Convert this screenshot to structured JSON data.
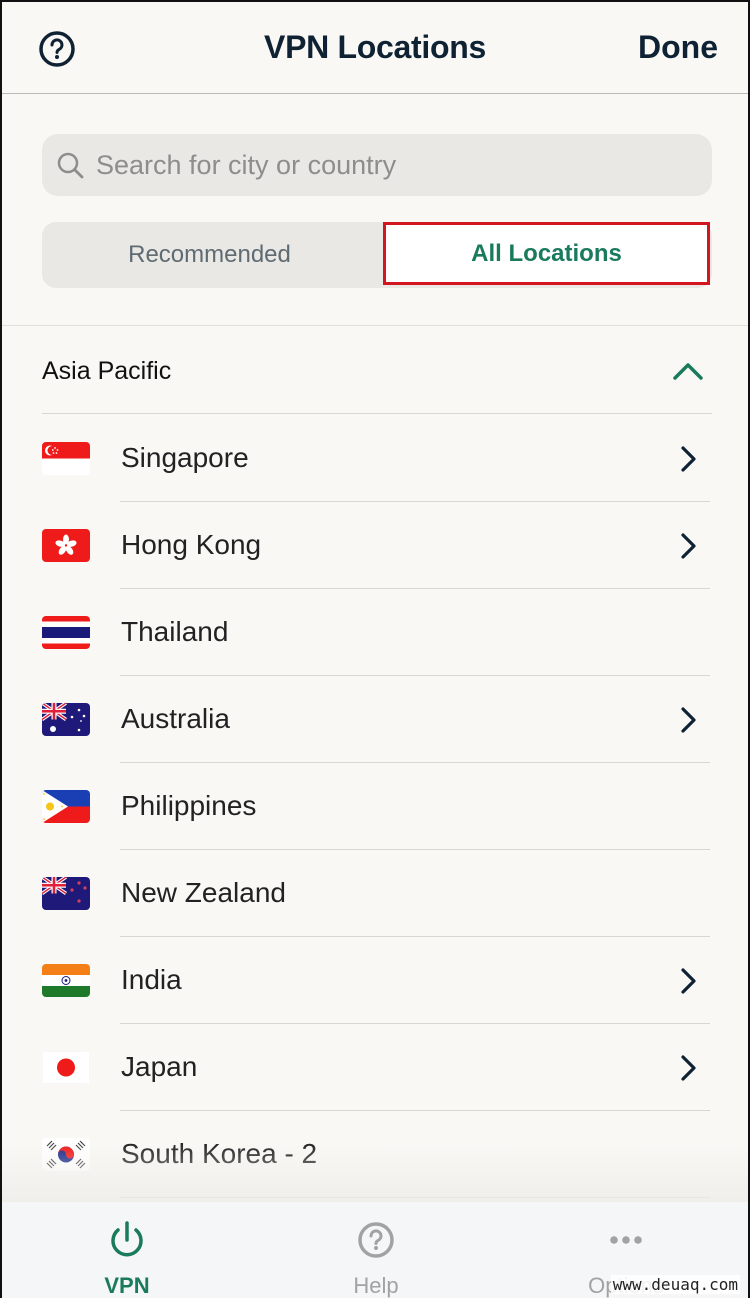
{
  "header": {
    "title": "VPN Locations",
    "done_label": "Done",
    "help_icon": "question-circle-icon"
  },
  "search": {
    "placeholder": "Search for city or country",
    "value": "",
    "icon": "search-icon"
  },
  "segments": {
    "recommended": "Recommended",
    "all_locations": "All Locations",
    "selected": "All Locations"
  },
  "region": {
    "label": "Asia Pacific",
    "expanded": true,
    "icon": "chevron-up-icon"
  },
  "locations": [
    {
      "name": "Singapore",
      "flag": "singapore-flag-icon",
      "has_submenu": true
    },
    {
      "name": "Hong Kong",
      "flag": "hong-kong-flag-icon",
      "has_submenu": true
    },
    {
      "name": "Thailand",
      "flag": "thailand-flag-icon",
      "has_submenu": false
    },
    {
      "name": "Australia",
      "flag": "australia-flag-icon",
      "has_submenu": true
    },
    {
      "name": "Philippines",
      "flag": "philippines-flag-icon",
      "has_submenu": false
    },
    {
      "name": "New Zealand",
      "flag": "new-zealand-flag-icon",
      "has_submenu": false
    },
    {
      "name": "India",
      "flag": "india-flag-icon",
      "has_submenu": true
    },
    {
      "name": "Japan",
      "flag": "japan-flag-icon",
      "has_submenu": true
    },
    {
      "name": "South Korea - 2",
      "flag": "south-korea-flag-icon",
      "has_submenu": false
    }
  ],
  "tabbar": {
    "tabs": [
      {
        "label": "VPN",
        "icon": "power-icon",
        "active": true
      },
      {
        "label": "Help",
        "icon": "question-circle-icon",
        "active": false
      },
      {
        "label": "Options",
        "icon": "ellipsis-icon",
        "active": false
      }
    ]
  },
  "colors": {
    "accent": "#1a7a5c",
    "text_dark": "#0f2233",
    "highlight_box": "#d2151e",
    "inactive": "#a2a2a2"
  },
  "watermark": "www.deuaq.com"
}
